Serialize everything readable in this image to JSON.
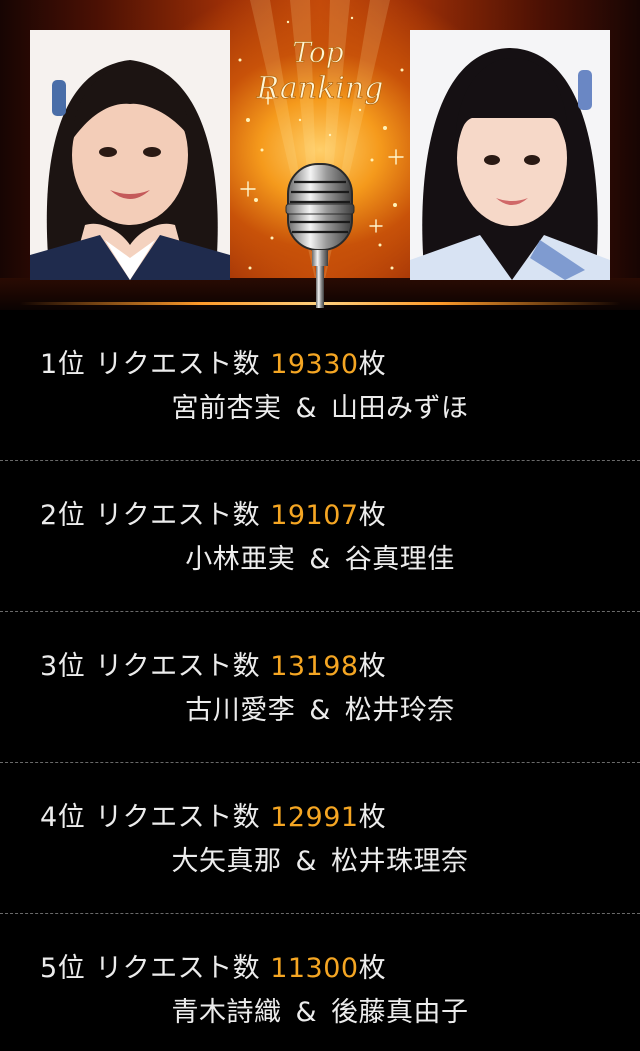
{
  "header": {
    "logo_line1": "Top",
    "logo_line2": "Ranking"
  },
  "ranking": {
    "rank_suffix": "位",
    "request_label": "リクエスト数",
    "unit": "枚",
    "separator": "&",
    "accent_color": "#f5a623",
    "text_color": "#ececec",
    "items": [
      {
        "rank": "1",
        "count": "19330",
        "member_a": "宮前杏実",
        "member_b": "山田みずほ"
      },
      {
        "rank": "2",
        "count": "19107",
        "member_a": "小林亜実",
        "member_b": "谷真理佳"
      },
      {
        "rank": "3",
        "count": "13198",
        "member_a": "古川愛李",
        "member_b": "松井玲奈"
      },
      {
        "rank": "4",
        "count": "12991",
        "member_a": "大矢真那",
        "member_b": "松井珠理奈"
      },
      {
        "rank": "5",
        "count": "11300",
        "member_a": "青木詩織",
        "member_b": "後藤真由子"
      }
    ]
  }
}
